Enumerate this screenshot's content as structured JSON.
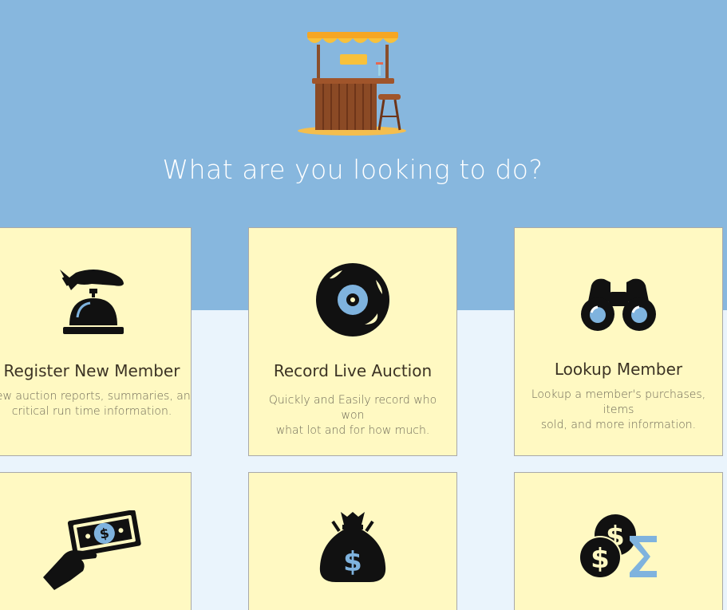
{
  "colors": {
    "hero_bg": "#87B7DE",
    "page_bg": "#EAF4FC",
    "card_bg": "#FFF9C2",
    "card_border": "#A9A9A9",
    "icon_dark": "#111111",
    "icon_accent": "#7FB3DE"
  },
  "hero": {
    "logo_icon": "tiki-bar-stand-icon",
    "title": "What are you looking to do?"
  },
  "cards": [
    {
      "icon": "service-bell-icon",
      "title": "Register New Member",
      "description": "iew auction reports, summaries, and\ncritical run time information."
    },
    {
      "icon": "vinyl-record-icon",
      "title": "Record Live Auction",
      "description": "Quickly and Easily record who won\nwhat lot and for how much."
    },
    {
      "icon": "binoculars-icon",
      "title": "Lookup Member",
      "description": "Lookup a member's purchases, items\nsold, and more information."
    },
    {
      "icon": "hand-with-cash-icon",
      "title": "",
      "description": ""
    },
    {
      "icon": "money-bag-icon",
      "title": "",
      "description": ""
    },
    {
      "icon": "coins-sum-icon",
      "title": "",
      "description": ""
    }
  ]
}
